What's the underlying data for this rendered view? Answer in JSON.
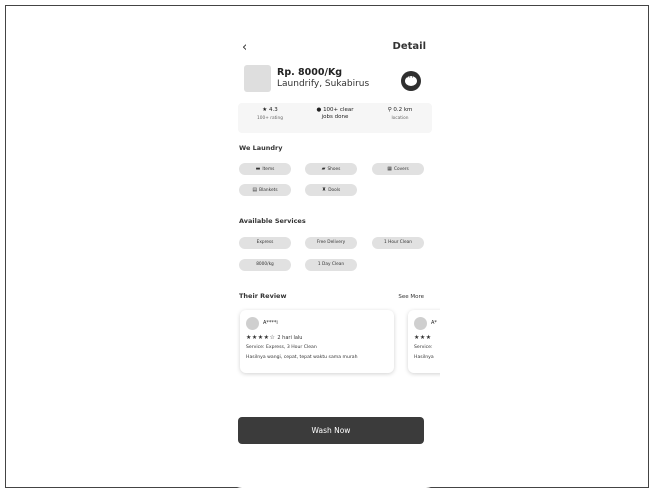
{
  "header": {
    "back_icon": "chevron-left-icon",
    "title": "Detail"
  },
  "shop": {
    "price": "Rp. 8000/Kg",
    "name": "Laundrify, Sukabirus",
    "chat_icon": "chat-bubble-icon"
  },
  "stats": [
    {
      "icon": "star-icon",
      "value": "4.3",
      "label": "100+ rating"
    },
    {
      "icon": "badge-icon",
      "value": "100+ clear",
      "label": "jobs done"
    },
    {
      "icon": "location-pin-icon",
      "value": "0.2 km",
      "label": "location"
    }
  ],
  "we_laundry": {
    "title": "We Laundry",
    "items": [
      {
        "icon": "shirt-icon",
        "label": "Items"
      },
      {
        "icon": "shoe-icon",
        "label": "Shoes"
      },
      {
        "icon": "cover-icon",
        "label": "Covers"
      },
      {
        "icon": "blanket-icon",
        "label": "Blankets"
      },
      {
        "icon": "doll-icon",
        "label": "Dools"
      }
    ]
  },
  "services": {
    "title": "Available Services",
    "items": [
      "Express",
      "Free Delivery",
      "1 Hour Clean",
      "8000/kg",
      "1 Day Clean"
    ]
  },
  "reviews": {
    "title": "Their Review",
    "see_more": "See More",
    "items": [
      {
        "name": "A****i",
        "stars": "★★★★☆",
        "when": "2 hari lalu",
        "service": "Service: Express, 3 Hour Clean",
        "text": "Hasilnya wangi, cepat, tepat waktu sama murah"
      },
      {
        "name": "A*",
        "stars": "★★★",
        "when": "",
        "service": "Service:",
        "text": "Hasilnya"
      }
    ]
  },
  "cta": {
    "label": "Wash Now"
  }
}
